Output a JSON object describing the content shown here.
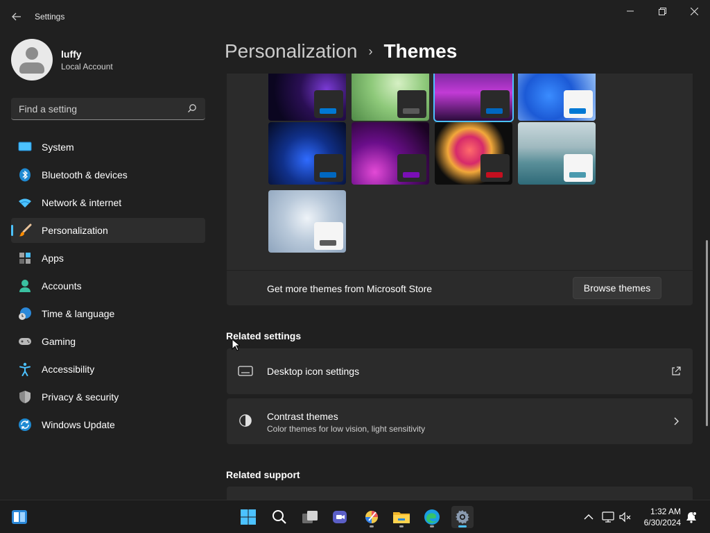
{
  "window": {
    "title": "Settings",
    "back_icon": "back-arrow-icon",
    "controls": [
      "minimize-icon",
      "restore-icon",
      "close-icon"
    ]
  },
  "profile": {
    "name": "luffy",
    "account_type": "Local Account"
  },
  "search": {
    "placeholder": "Find a setting"
  },
  "sidebar": {
    "items": [
      {
        "label": "System",
        "icon": "system-icon",
        "active": false
      },
      {
        "label": "Bluetooth & devices",
        "icon": "bluetooth-icon",
        "active": false
      },
      {
        "label": "Network & internet",
        "icon": "wifi-icon",
        "active": false
      },
      {
        "label": "Personalization",
        "icon": "brush-icon",
        "active": true
      },
      {
        "label": "Apps",
        "icon": "apps-icon",
        "active": false
      },
      {
        "label": "Accounts",
        "icon": "accounts-icon",
        "active": false
      },
      {
        "label": "Time & language",
        "icon": "globe-clock-icon",
        "active": false
      },
      {
        "label": "Gaming",
        "icon": "gamepad-icon",
        "active": false
      },
      {
        "label": "Accessibility",
        "icon": "accessibility-icon",
        "active": false
      },
      {
        "label": "Privacy & security",
        "icon": "shield-icon",
        "active": false
      },
      {
        "label": "Windows Update",
        "icon": "update-icon",
        "active": false
      }
    ]
  },
  "header": {
    "parent": "Personalization",
    "separator": "›",
    "current": "Themes"
  },
  "themes": {
    "accent_colors": [
      "#0078d4",
      "#5a5a5a",
      "#0067c0",
      "#0078d4",
      "#0067c0",
      "#7a0fb5",
      "#c50f1f",
      "#4a9aae",
      "#5a5a5a"
    ],
    "selected_index": 2,
    "store_text": "Get more themes from Microsoft Store",
    "browse_button": "Browse themes"
  },
  "related_settings": {
    "title": "Related settings",
    "items": [
      {
        "title": "Desktop icon settings",
        "subtitle": "",
        "icon": "monitor-icon",
        "action_icon": "open-external-icon"
      },
      {
        "title": "Contrast themes",
        "subtitle": "Color themes for low vision, light sensitivity",
        "icon": "contrast-icon",
        "action_icon": "chevron-right-icon"
      }
    ]
  },
  "related_support": {
    "title": "Related support"
  },
  "taskbar": {
    "apps": [
      "start-icon",
      "search-icon",
      "task-view-icon",
      "teams-icon",
      "paint-icon",
      "file-explorer-icon",
      "edge-icon",
      "settings-icon"
    ],
    "tray": [
      "chevron-up-icon",
      "network-icon",
      "volume-muted-icon"
    ],
    "time": "1:32 AM",
    "date": "6/30/2024",
    "notification_icon": "notification-bell-icon"
  },
  "colors": {
    "accent": "#4cc2ff",
    "background": "#202020",
    "card": "#2b2b2b"
  }
}
